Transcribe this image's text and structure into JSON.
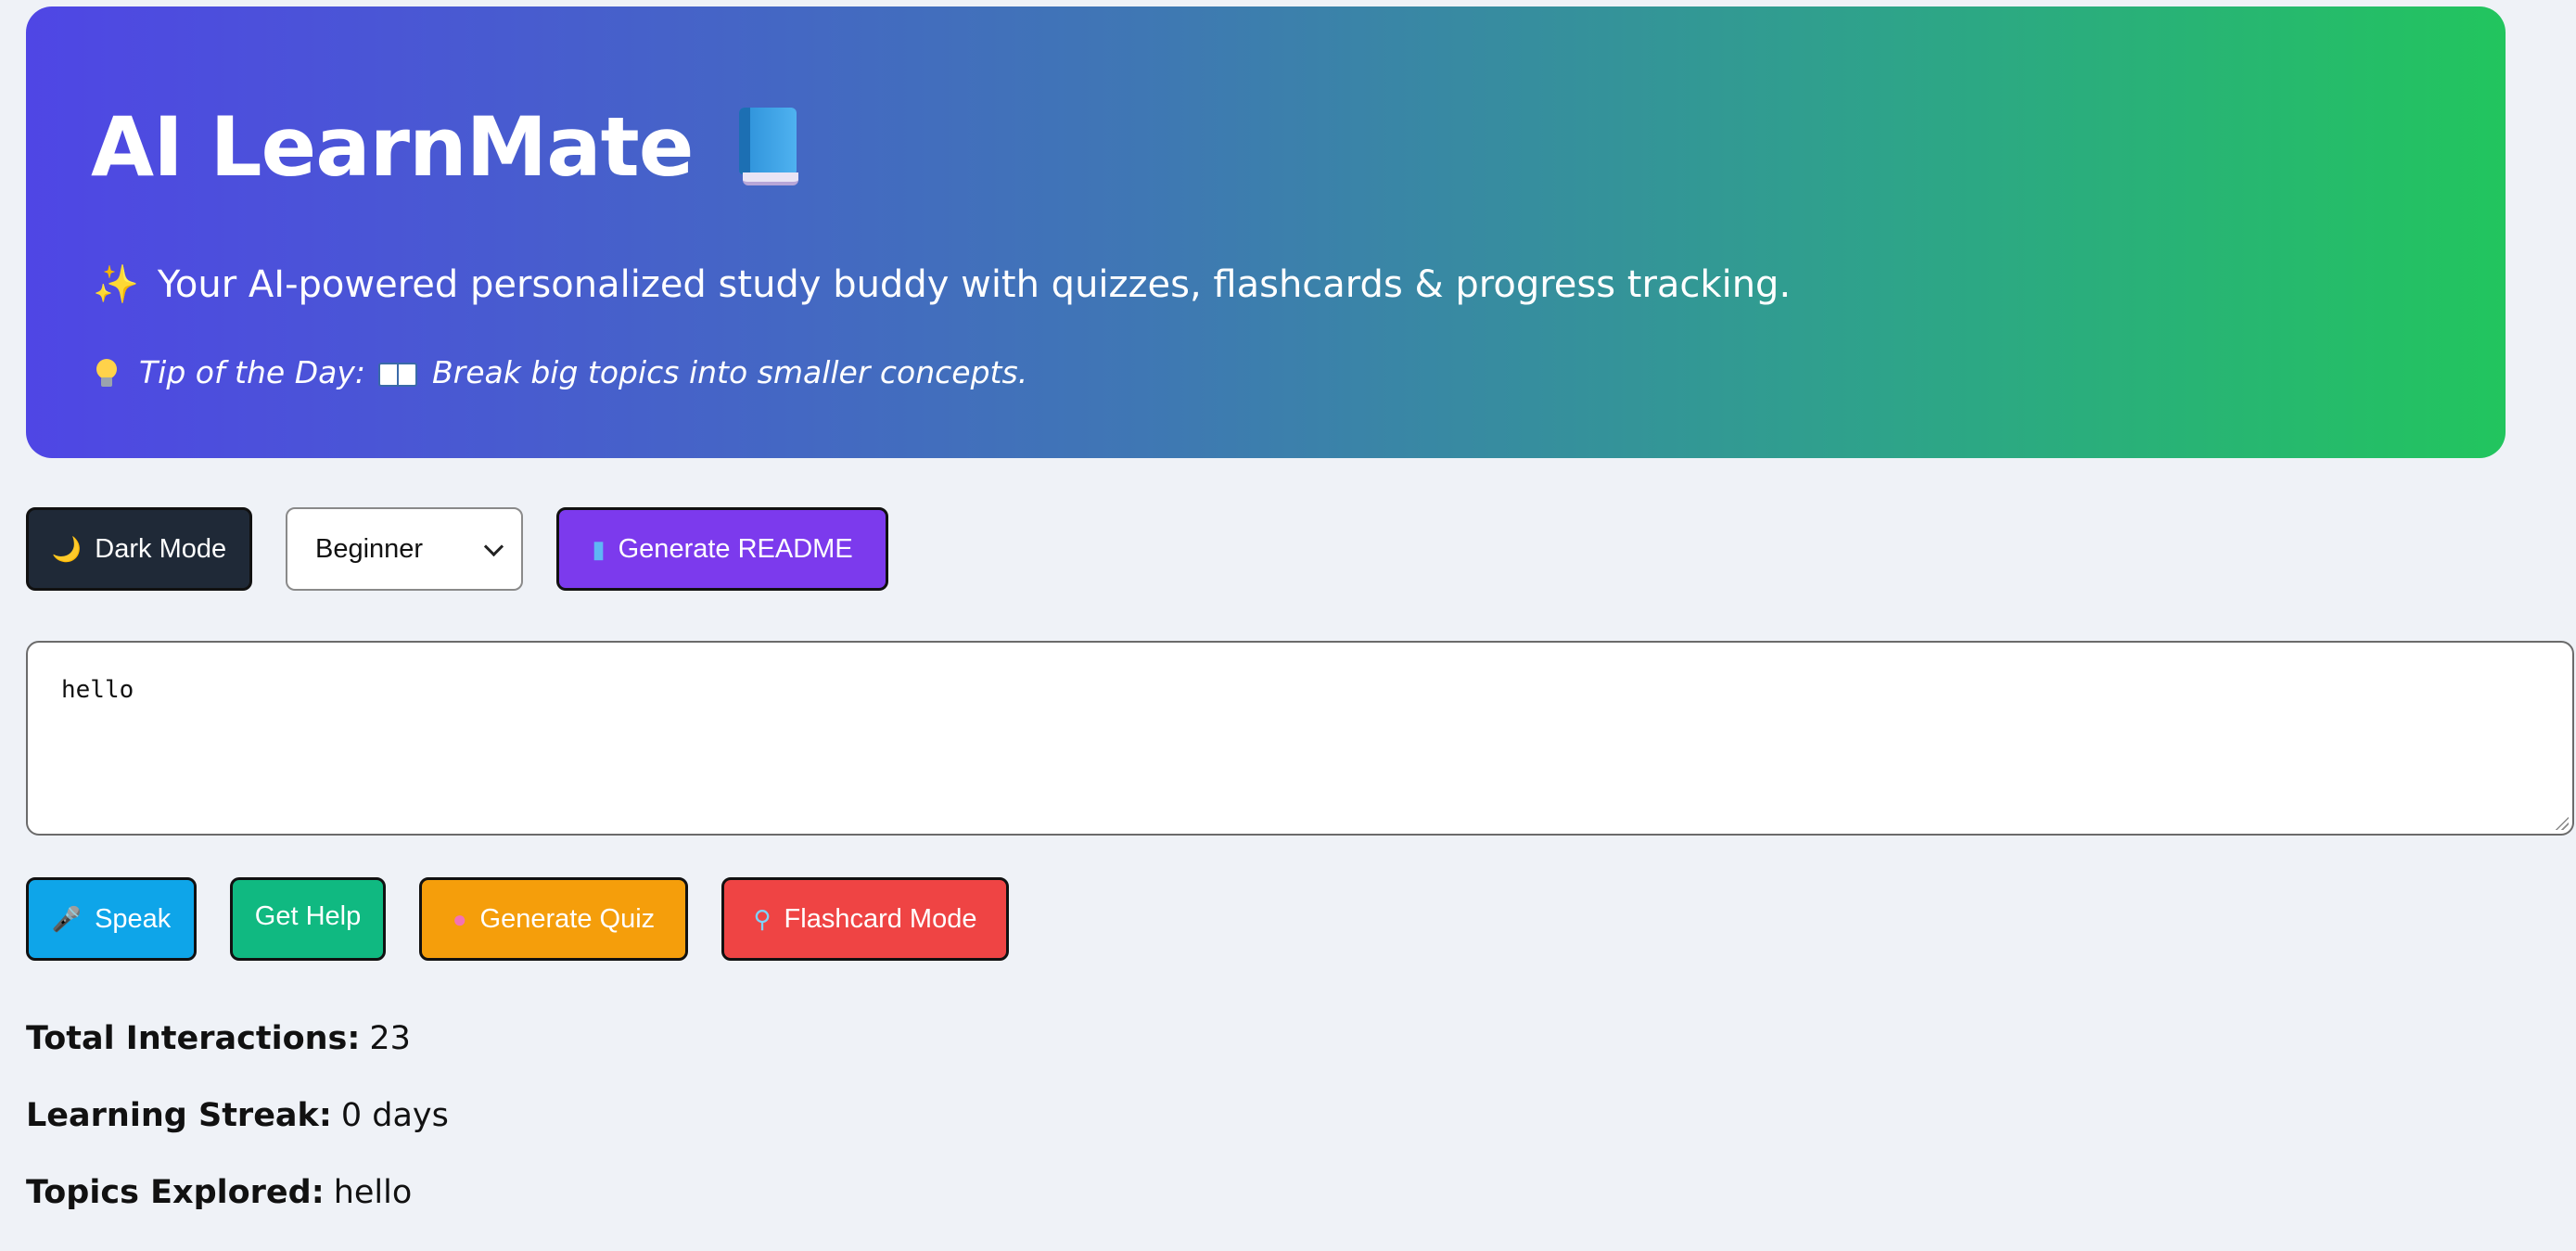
{
  "hero": {
    "title": "AI LearnMate",
    "title_icon": "book-icon",
    "subtitle": "Your AI-powered personalized study buddy with quizzes, flashcards & progress tracking.",
    "subtitle_icon": "sparkles-icon",
    "tip_label": "Tip of the Day:",
    "tip_text": "Break big topics into smaller concepts.",
    "gradient": [
      "#4f46e5",
      "#22c55e"
    ]
  },
  "controls": {
    "dark_mode_label": "Dark Mode",
    "level_selected": "Beginner",
    "generate_readme_label": "Generate README"
  },
  "prompt": {
    "value": "hello"
  },
  "actions": {
    "speak_label": "Speak",
    "get_help_label": "Get Help",
    "generate_quiz_label": "Generate Quiz",
    "flashcard_mode_label": "Flashcard Mode"
  },
  "stats": {
    "total_interactions_label": "Total Interactions:",
    "total_interactions_value": "23",
    "learning_streak_label": "Learning Streak:",
    "learning_streak_value": "0 days",
    "topics_explored_label": "Topics Explored:",
    "topics_explored_value": "hello"
  },
  "colors": {
    "dark_mode": "#1f2937",
    "generate_readme": "#7c3aed",
    "speak": "#0ea5e9",
    "get_help": "#10b981",
    "generate_quiz": "#f59e0b",
    "flashcard_mode": "#ef4444",
    "page_background": "#eff2f7"
  }
}
